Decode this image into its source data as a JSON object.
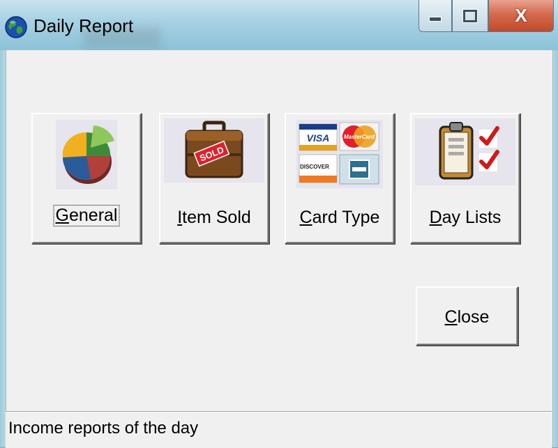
{
  "window": {
    "title": "Daily Report",
    "icon": "globe-icon",
    "controls": {
      "minimize_icon": "minimize-icon",
      "maximize_icon": "maximize-icon",
      "close_glyph": "X"
    }
  },
  "report_buttons": [
    {
      "label": "General",
      "mnemonic": "G",
      "icon": "pie-chart-icon"
    },
    {
      "label": "Item Sold",
      "mnemonic": "I",
      "icon": "sold-briefcase-icon"
    },
    {
      "label": "Card Type",
      "mnemonic": "C",
      "icon": "credit-cards-icon"
    },
    {
      "label": "Day Lists",
      "mnemonic": "D",
      "icon": "clipboard-checklist-icon"
    }
  ],
  "card_logos": {
    "visa": "VISA",
    "mastercard": "MasterCard",
    "discover": "DISCOVER"
  },
  "briefcase_tag": "SOLD",
  "close_button": {
    "label": "Close",
    "mnemonic": "C"
  },
  "status_bar": {
    "text": "Income reports of the day"
  }
}
